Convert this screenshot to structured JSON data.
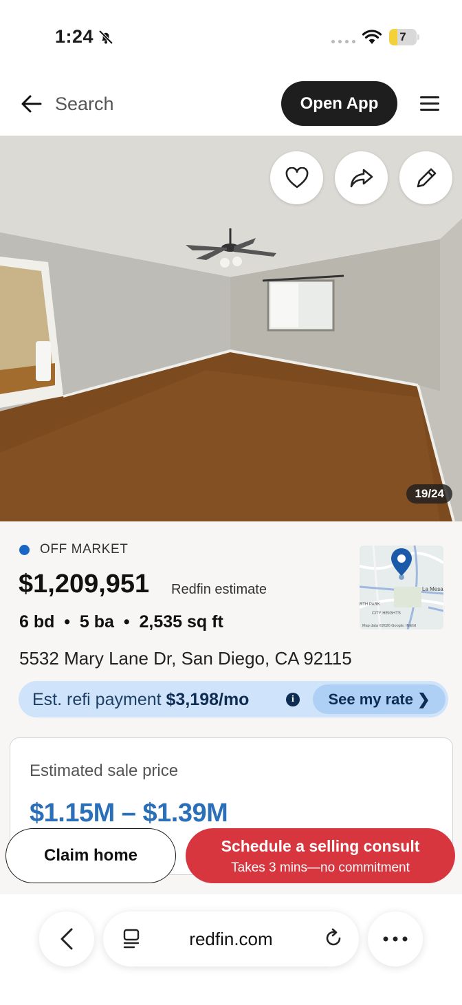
{
  "status_bar": {
    "time": "1:24",
    "battery_level": "7"
  },
  "nav": {
    "search_label": "Search",
    "open_app_label": "Open App"
  },
  "photo": {
    "counter": "19/24"
  },
  "listing": {
    "status": "OFF MARKET",
    "price": "$1,209,951",
    "price_label": "Redfin estimate",
    "stats": "6 bd  •  5 ba  •  2,535 sq ft",
    "address": "5532 Mary Lane Dr, San Diego, CA 92115",
    "map_label_city": "La Mesa",
    "map_label_heights": "CITY HEIGHTS",
    "map_label_park": "RTH PARK",
    "map_credit": "Map data ©2026 Google, INEGI"
  },
  "refi": {
    "text_prefix": "Est. refi payment ",
    "amount": "$3,198/mo",
    "info_glyph": "i",
    "cta": "See my rate ❯"
  },
  "sale": {
    "label": "Estimated sale price",
    "range": "$1.15M – $1.39M"
  },
  "cta": {
    "claim": "Claim home",
    "consult_title": "Schedule a selling consult",
    "consult_sub": "Takes 3 mins—no commitment"
  },
  "browser": {
    "url": "redfin.com"
  },
  "colors": {
    "accent_red": "#d7363f",
    "link_blue": "#2a6fb8",
    "refi_bg": "#cfe3fb",
    "status_blue": "#1a66c7"
  }
}
